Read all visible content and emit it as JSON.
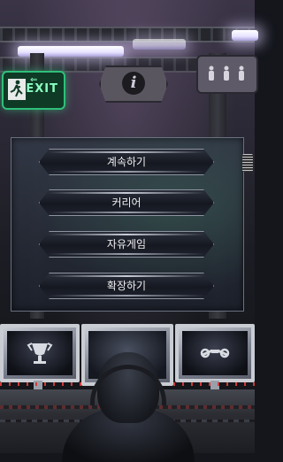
{
  "menu": {
    "items": [
      {
        "label": "계속하기"
      },
      {
        "label": "커리어"
      },
      {
        "label": "자유게임"
      },
      {
        "label": "확장하기"
      }
    ]
  },
  "signs": {
    "exit_label": "EXIT",
    "exit_arrow": "⇐",
    "info_glyph": "i"
  },
  "monitors": {
    "left_icon": "trophy-icon",
    "center_icon": "blank-screen",
    "right_icon": "wrench-icon"
  },
  "colors": {
    "exit_green": "#2fbf7a",
    "menu_text": "#f2f2f4",
    "panel_bg": "#2a2f3a"
  }
}
